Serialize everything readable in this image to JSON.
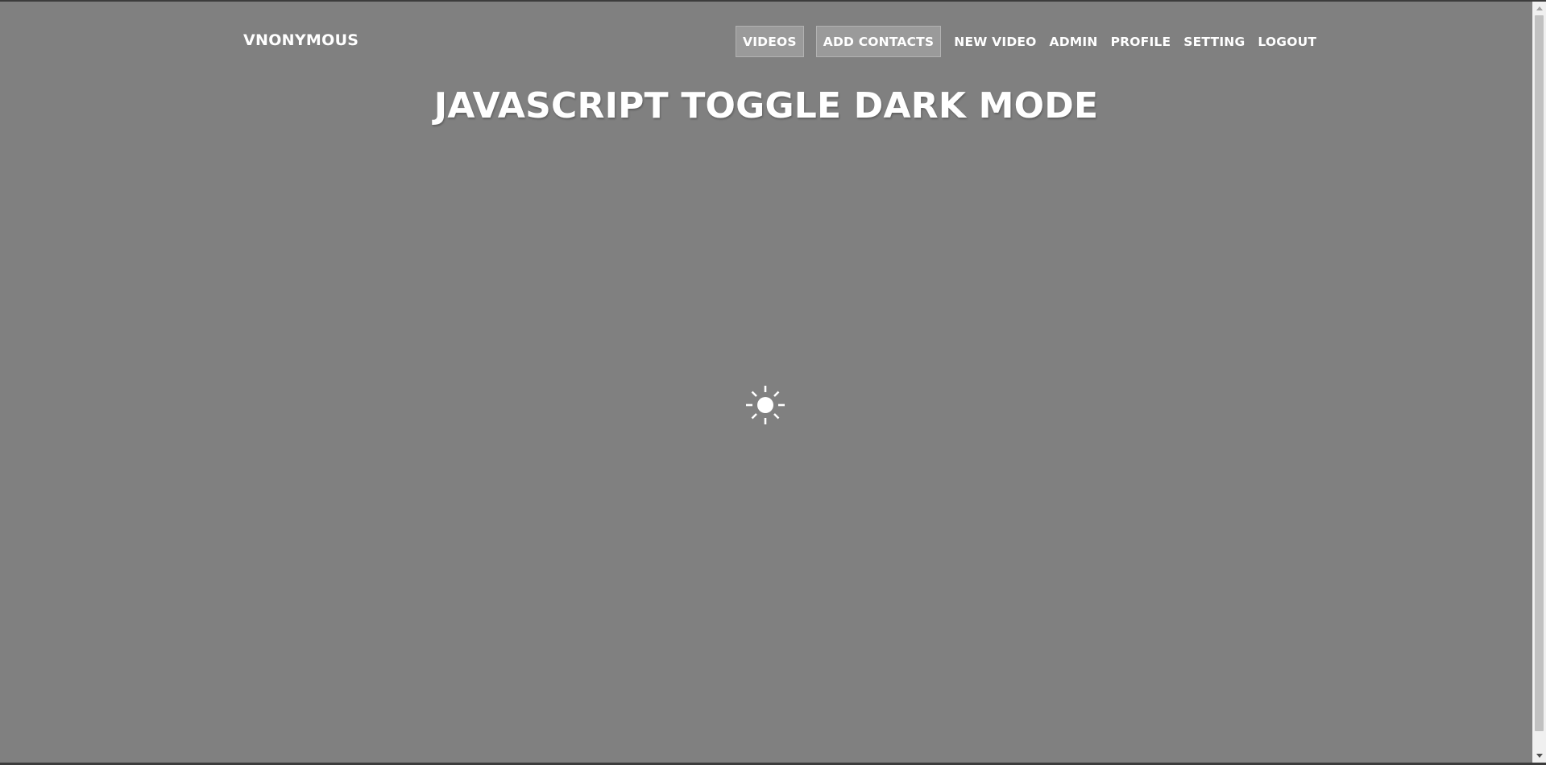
{
  "brand": {
    "label": "VNONYMOUS"
  },
  "nav": {
    "items": [
      {
        "label": "VIDEOS",
        "style": "boxed"
      },
      {
        "label": "ADD CONTACTS",
        "style": "boxed"
      },
      {
        "label": "NEW VIDEO",
        "style": "plain"
      },
      {
        "label": "ADMIN",
        "style": "plain"
      },
      {
        "label": "PROFILE",
        "style": "plain"
      },
      {
        "label": "SETTING",
        "style": "plain"
      },
      {
        "label": "LOGOUT",
        "style": "plain"
      }
    ]
  },
  "main": {
    "title": "JAVASCRIPT TOGGLE DARK MODE",
    "toggle_icon": "sun-icon"
  },
  "colors": {
    "background": "#808080",
    "text": "#ffffff",
    "nav_highlight": "#9a9a9a",
    "scrollbar_track": "#f0f0f0",
    "scrollbar_thumb": "#c1c1c1"
  }
}
